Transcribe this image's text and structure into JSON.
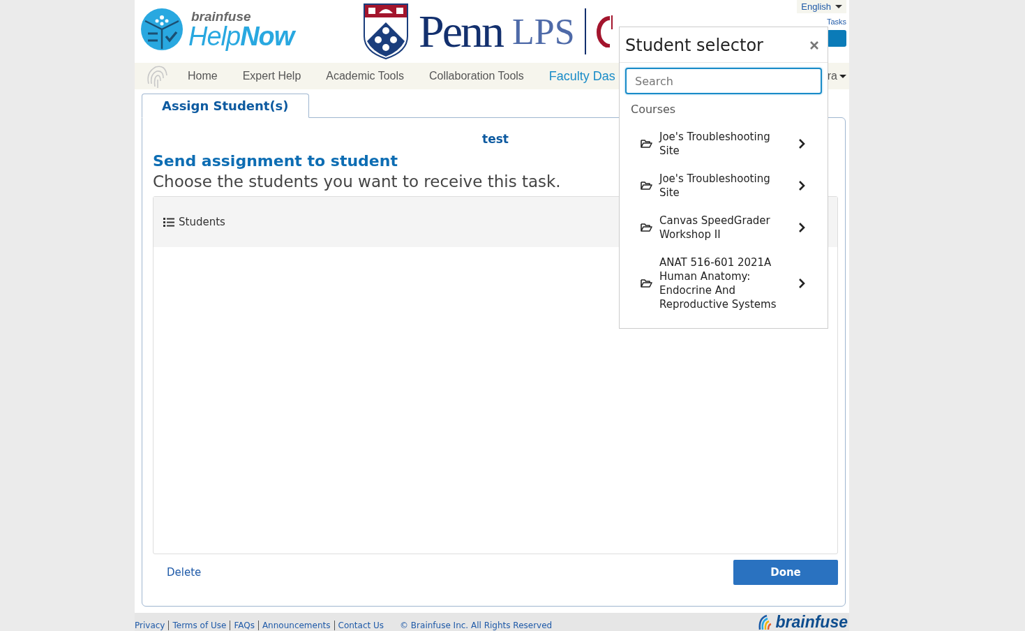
{
  "header": {
    "brand_small": "brainfuse",
    "brand_help": "Help",
    "brand_now": "Now",
    "partner": "Penn",
    "partner_sub": "LPS",
    "language": "English",
    "tasks_link": "Tasks"
  },
  "nav": [
    {
      "label": "Home",
      "selected": false
    },
    {
      "label": "Expert Help",
      "selected": false
    },
    {
      "label": "Academic Tools",
      "selected": false
    },
    {
      "label": "Collaboration Tools",
      "selected": false
    },
    {
      "label": "Faculty Das",
      "selected": true
    }
  ],
  "nav_more": "ra",
  "tab": {
    "label": "Assign Student(s)",
    "selected": true
  },
  "task_name": "test",
  "heading": "Send assignment to student",
  "subheading": "Choose the students you want to receive this task.",
  "students_panel": {
    "title": "Students"
  },
  "delete_link": "Delete",
  "done_button": "Done",
  "popup": {
    "title": "Student selector",
    "search": {
      "placeholder": "Search"
    },
    "section": "Courses",
    "items": [
      {
        "label": "Joe's Troubleshooting Site"
      },
      {
        "label": "Joe's Troubleshooting Site"
      },
      {
        "label": "Canvas SpeedGrader Workshop II"
      },
      {
        "label": "ANAT 516-601 2021A Human Anatomy: Endocrine And Reproductive Systems"
      }
    ]
  },
  "footer": {
    "links": [
      "Privacy",
      "Terms of Use",
      "FAQs",
      "Announcements",
      "Contact Us"
    ],
    "copyright": "© Brainfuse Inc. All Rights Reserved",
    "logo": "brainfuse"
  }
}
